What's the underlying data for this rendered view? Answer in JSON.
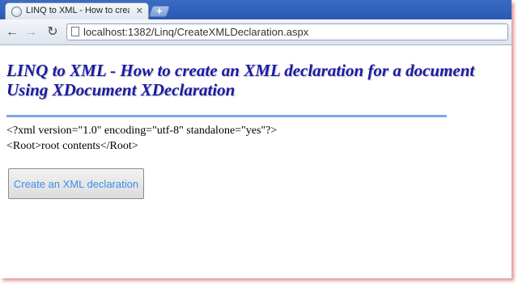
{
  "browser": {
    "tab": {
      "title": "LINQ to XML - How to creat",
      "close_label": "✕",
      "favicon": "globe-icon"
    },
    "new_tab_label": "+",
    "nav": {
      "back": "←",
      "forward": "→",
      "reload": "↻"
    },
    "address": {
      "url": "localhost:1382/Linq/CreateXMLDeclaration.aspx"
    }
  },
  "page": {
    "heading_line1": "LINQ to XML - How to create an XML declaration for a document",
    "heading_line2": "Using XDocument XDeclaration",
    "xml_output": [
      "<?xml version=\"1.0\" encoding=\"utf-8\" standalone=\"yes\"?>",
      "<Root>root contents</Root>"
    ],
    "button_label": "Create an XML declaration"
  },
  "colors": {
    "heading": "#1a1aa6",
    "rule": "#7fa6e8",
    "button_text": "#3d8ee8",
    "tabstrip": "#2a58b0"
  }
}
